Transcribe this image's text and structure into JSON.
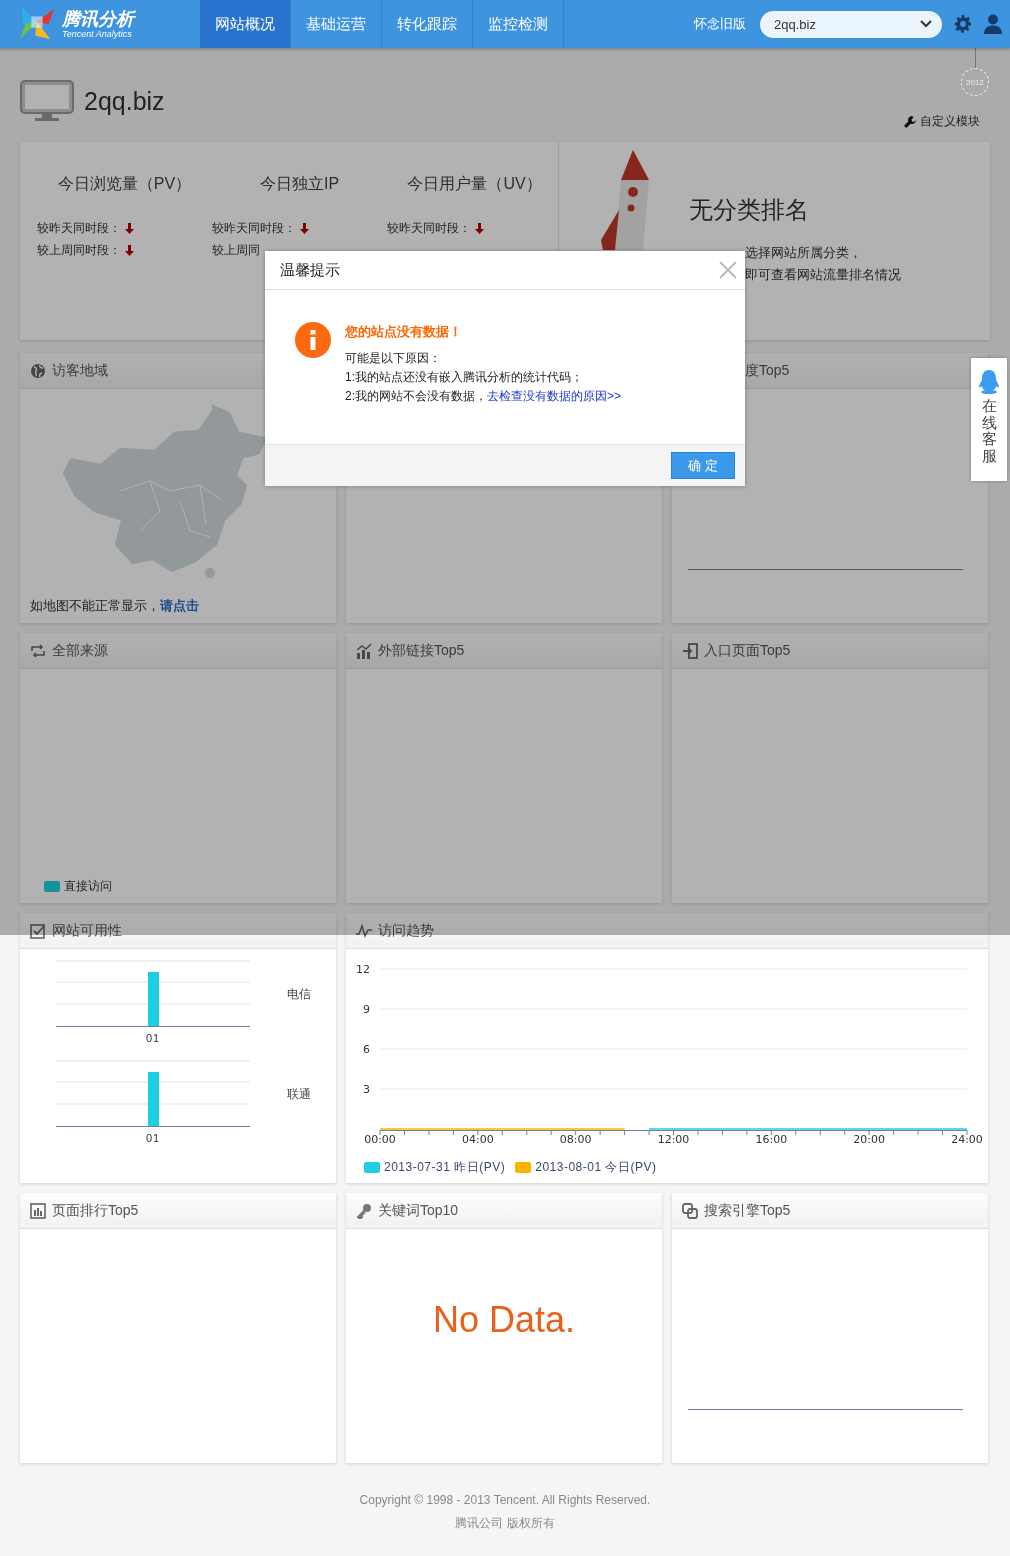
{
  "header": {
    "logo_title": "腾讯分析",
    "logo_subtitle": "Tencent Analytics",
    "nav": [
      {
        "label": "网站概况",
        "selected": true
      },
      {
        "label": "基础运营",
        "selected": false
      },
      {
        "label": "转化跟踪",
        "selected": false
      },
      {
        "label": "监控检测",
        "selected": false
      }
    ],
    "old_version_link": "怀念旧版",
    "site_select": {
      "value": "2qq.biz"
    }
  },
  "timeline_badge": "2012",
  "site": {
    "name": "2qq.biz"
  },
  "customize_link": "自定义模块",
  "stats": [
    {
      "title": "今日浏览量（PV）",
      "rows": [
        {
          "label": "较昨天同时段：",
          "falling": true
        },
        {
          "label": "较上周同时段：",
          "falling": true
        }
      ]
    },
    {
      "title": "今日独立IP",
      "rows": [
        {
          "label": "较昨天同时段：",
          "falling": true
        },
        {
          "label": "较上周同"
        }
      ]
    },
    {
      "title": "今日用户量（UV）",
      "rows": [
        {
          "label": "较昨天同时段：",
          "falling": true
        }
      ]
    }
  ],
  "ranking": {
    "title": "无分类排名",
    "lines": [
      "选择网站所属分类，",
      "即可查看网站流量排名情况"
    ]
  },
  "panels": [
    {
      "title": "访客地域",
      "kind": "map",
      "note": "如地图不能正常显示，",
      "note_link": "请点击"
    },
    {
      "kind": "empty"
    },
    {
      "title": "度Top5",
      "kind": "rule"
    },
    {
      "title": "全部来源",
      "kind": "legend",
      "legend": [
        {
          "name": "直接访问",
          "color": "#15919c"
        }
      ]
    },
    {
      "title": "外部链接Top5",
      "kind": "empty"
    },
    {
      "title": "入口页面Top5",
      "kind": "empty"
    },
    {
      "title": "网站可用性",
      "kind": "availability",
      "carriers": [
        {
          "name": "电信",
          "x_label": "01"
        },
        {
          "name": "联通",
          "x_label": "01"
        }
      ]
    },
    {
      "title": "访问趋势",
      "kind": "trend",
      "chart_data": {
        "type": "line",
        "x": [
          0,
          1,
          2,
          3,
          4,
          5,
          6,
          7,
          8,
          9,
          10,
          11,
          12,
          13,
          14,
          15,
          16,
          17,
          18,
          19,
          20,
          21,
          22,
          23,
          24
        ],
        "series": [
          {
            "name": "2013-07-31 昨日(PV)",
            "color": "#1ecfdf",
            "values": [
              null,
              null,
              null,
              null,
              null,
              null,
              null,
              null,
              null,
              null,
              null,
              0,
              0,
              0,
              0,
              0,
              0,
              0,
              0,
              0,
              0,
              0,
              0,
              0,
              0
            ]
          },
          {
            "name": "2013-08-01 今日(PV)",
            "color": "#f9b400",
            "values": [
              0,
              0,
              0,
              0,
              0,
              0,
              0,
              0,
              0,
              0,
              0,
              null,
              null,
              null,
              null,
              null,
              null,
              null,
              null,
              null,
              null,
              null,
              null,
              null,
              null
            ]
          }
        ],
        "xlim": [
          0,
          24
        ],
        "ylim": [
          0,
          12
        ],
        "yticks": [
          3,
          6,
          9,
          12
        ],
        "grid": true,
        "legend": "bottom",
        "xticks": [
          {
            "value": 0,
            "label": "00:00"
          },
          {
            "value": 4,
            "label": "04:00"
          },
          {
            "value": 8,
            "label": "08:00"
          },
          {
            "value": 12,
            "label": "12:00"
          },
          {
            "value": 16,
            "label": "16:00"
          },
          {
            "value": 20,
            "label": "20:00"
          },
          {
            "value": 24,
            "label": "24:00"
          }
        ]
      }
    },
    {
      "title": "页面排行Top5",
      "kind": "empty"
    },
    {
      "title": "关键词Top10",
      "kind": "no_data",
      "message": "No Data."
    },
    {
      "title": "搜索引擎Top5",
      "kind": "rule"
    }
  ],
  "footer": {
    "copyright": "Copyright © 1998 - 2013 Tencent. All Rights Reserved.",
    "company": "腾讯公司 版权所有"
  },
  "dialog": {
    "title": "温馨提示",
    "heading": "您的站点没有数据！",
    "lines": [
      "可能是以下原因：",
      "1:我的站点还没有嵌入腾讯分析的统计代码；"
    ],
    "last_line": "2:我的网站不会没有数据，",
    "last_link": "去检查没有数据的原因>>",
    "button": "确 定"
  },
  "side_service": {
    "label": "在线客服"
  }
}
